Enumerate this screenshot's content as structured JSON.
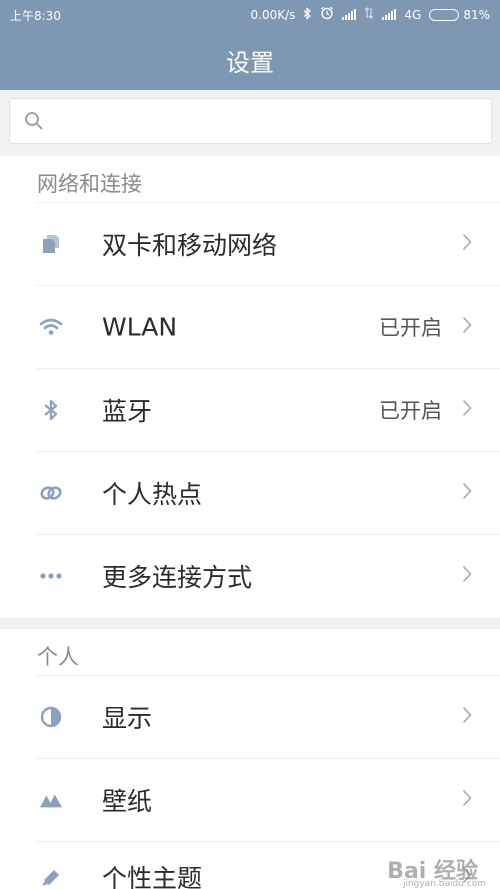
{
  "status_bar": {
    "time": "上午8:30",
    "net_speed": "0.00K/s",
    "network_type": "4G",
    "battery_percent_label": "81%",
    "battery_level": 0.81
  },
  "header": {
    "title": "设置"
  },
  "search": {
    "placeholder": ""
  },
  "sections": [
    {
      "header": "网络和连接",
      "items": [
        {
          "label": "双卡和移动网络",
          "value": "",
          "icon": "dual-sim-icon"
        },
        {
          "label": "WLAN",
          "value": "已开启",
          "icon": "wifi-icon"
        },
        {
          "label": "蓝牙",
          "value": "已开启",
          "icon": "bluetooth-icon"
        },
        {
          "label": "个人热点",
          "value": "",
          "icon": "hotspot-link-icon"
        },
        {
          "label": "更多连接方式",
          "value": "",
          "icon": "more-dots-icon"
        }
      ]
    },
    {
      "header": "个人",
      "items": [
        {
          "label": "显示",
          "value": "",
          "icon": "display-contrast-icon"
        },
        {
          "label": "壁纸",
          "value": "",
          "icon": "wallpaper-mountain-icon"
        },
        {
          "label": "个性主题",
          "value": "",
          "icon": "theme-brush-icon"
        }
      ]
    }
  ],
  "watermark": {
    "text": "Bai 经验",
    "sub": "jingyan.baidu.com"
  },
  "colors": {
    "accent": "#7e97b3",
    "icon": "#8aa2bf"
  }
}
